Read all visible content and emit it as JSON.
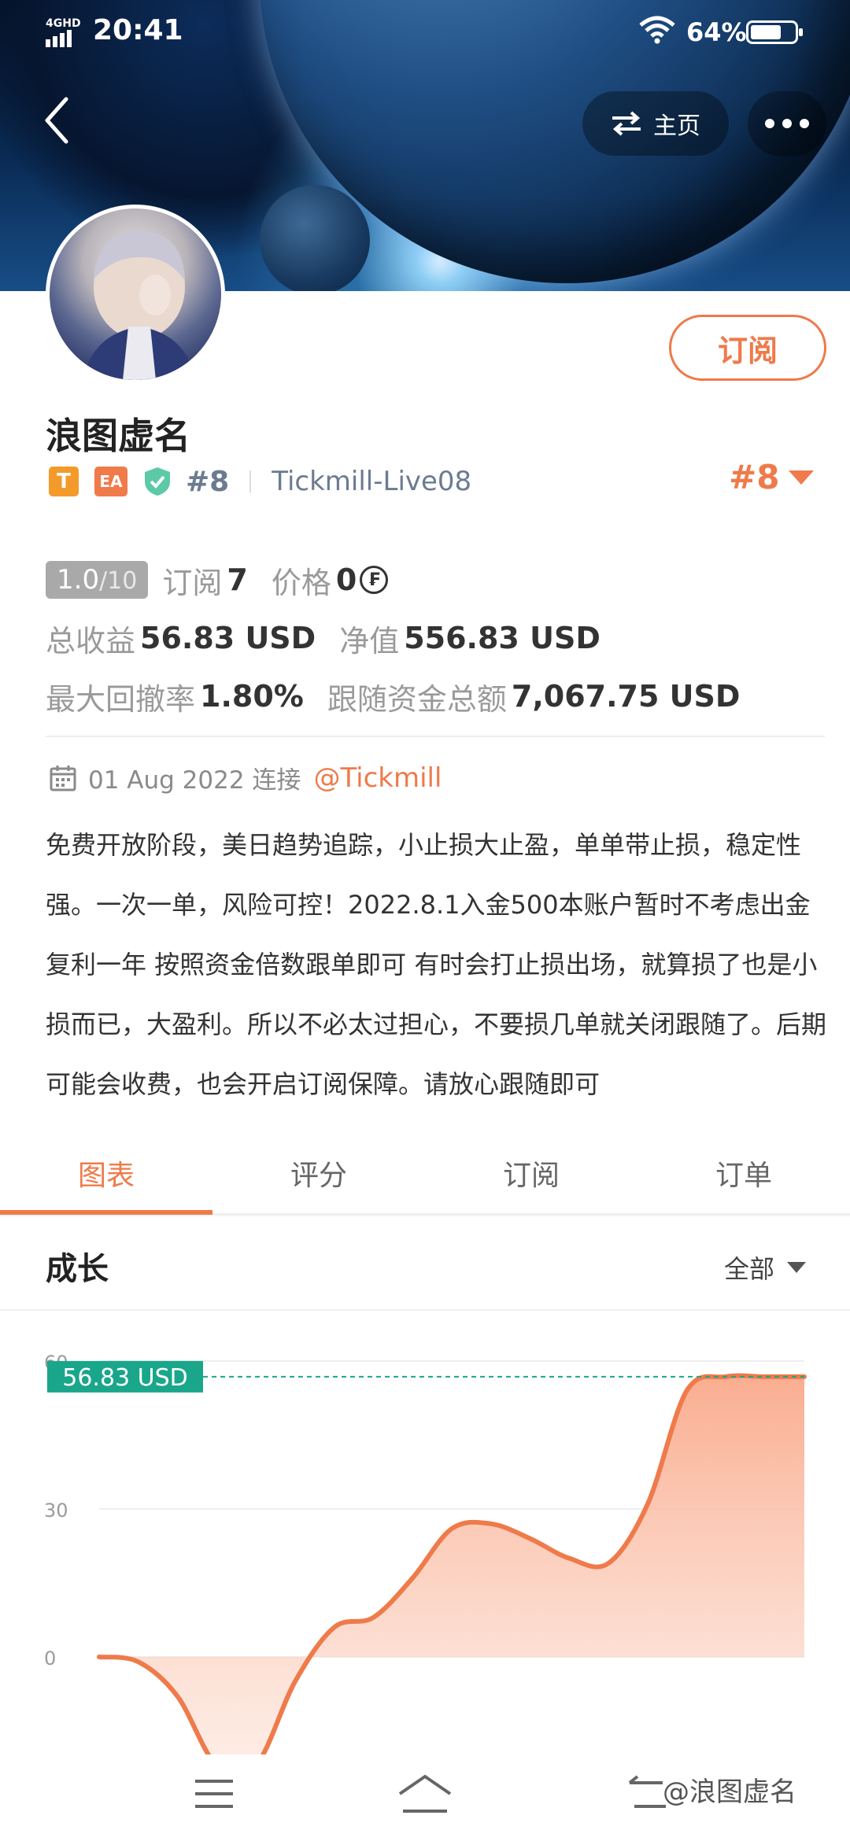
{
  "status_bar": {
    "network": "4GHD",
    "time": "20:41",
    "battery": "64%"
  },
  "header": {
    "home_label": "主页"
  },
  "profile": {
    "name": "浪图虚名",
    "subscribe_label": "订阅",
    "tag_t": "T",
    "tag_ea": "EA",
    "rank": "#8",
    "broker": "Tickmill-Live08",
    "rank_right": "#8"
  },
  "stats": {
    "score": "1.0",
    "score_max": "/10",
    "subscribe_label": "订阅",
    "subscribe_count": "7",
    "price_label": "价格",
    "price_value": "0",
    "price_coin": "₣",
    "total_profit_label": "总收益",
    "total_profit_value": "56.83 USD",
    "equity_label": "净值",
    "equity_value": "556.83 USD",
    "max_dd_label": "最大回撤率",
    "max_dd_value": "1.80%",
    "follow_label": "跟随资金总额",
    "follow_value": "7,067.75 USD"
  },
  "connection": {
    "date_text": "01 Aug 2022 连接",
    "handle": "@Tickmill"
  },
  "description": "免费开放阶段，美日趋势追踪，小止损大止盈，单单带止损，稳定性强。一次一单，风险可控！2022.8.1入金500本账户暂时不考虑出金复利一年 按照资金倍数跟单即可 有时会打止损出场，就算损了也是小损而已，大盈利。所以不必太过担心，不要损几单就关闭跟随了。后期可能会收费，也会开启订阅保障。请放心跟随即可",
  "tabs": [
    {
      "label": "图表",
      "active": true
    },
    {
      "label": "评分",
      "active": false
    },
    {
      "label": "订阅",
      "active": false
    },
    {
      "label": "订单",
      "active": false
    }
  ],
  "growth": {
    "title": "成长",
    "filter": "全部"
  },
  "chart_data": {
    "type": "area",
    "ylim": [
      -23,
      60
    ],
    "yticks": [
      "60",
      "30",
      "0"
    ],
    "current_label": "56.83 USD",
    "current_value": 56.83,
    "series": [
      {
        "values": [
          0,
          -1,
          -8,
          -22,
          -22,
          -5,
          6,
          8,
          16,
          26,
          27,
          24,
          20,
          19,
          31,
          54,
          56.83,
          56.83,
          56.83
        ]
      }
    ],
    "colors": {
      "line": "#ef7a4a",
      "fill": "#f9b9a0",
      "marker": "#1aa68a"
    }
  },
  "watermark": "@浪图虚名"
}
